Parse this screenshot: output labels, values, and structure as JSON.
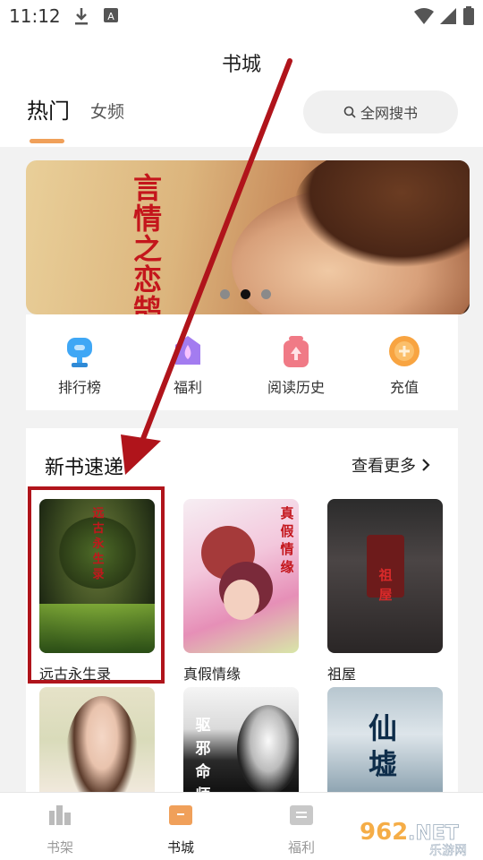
{
  "status_bar": {
    "time": "11:12"
  },
  "page_title": "书城",
  "tabs": [
    {
      "label": "热门",
      "active": true
    },
    {
      "label": "女频",
      "active": false
    }
  ],
  "search": {
    "label": "全网搜书"
  },
  "banner": {
    "title_chars": [
      "言",
      "情",
      "之",
      "恋",
      "鹄"
    ],
    "page_count": 3,
    "active_page": 2
  },
  "quick_actions": [
    {
      "label": "排行榜",
      "icon": "trophy-icon",
      "color": "#3fa7f5"
    },
    {
      "label": "福利",
      "icon": "gift-icon",
      "color": "#a37cf0"
    },
    {
      "label": "阅读历史",
      "icon": "history-icon",
      "color": "#f07a86"
    },
    {
      "label": "充值",
      "icon": "coin-icon",
      "color": "#f8a441"
    }
  ],
  "new_books": {
    "title": "新书速递",
    "more_label": "查看更多",
    "books": [
      {
        "name": "远古永生录",
        "cover_text": "远古永生录"
      },
      {
        "name": "真假情缘",
        "cover_text": "真假情缘"
      },
      {
        "name": "祖屋",
        "cover_text": "祖屋"
      },
      {
        "name": "",
        "cover_text": ""
      },
      {
        "name": "",
        "cover_text": "驱邪命师"
      },
      {
        "name": "",
        "cover_text": "仙墟"
      }
    ]
  },
  "bottom_nav": [
    {
      "label": "书架",
      "icon": "bookshelf-icon",
      "active": false
    },
    {
      "label": "书城",
      "icon": "bookstore-icon",
      "active": true
    },
    {
      "label": "福利",
      "icon": "welfare-icon",
      "active": false
    }
  ],
  "watermark": {
    "text": "962.NET",
    "subtext": "乐游网"
  },
  "colors": {
    "accent": "#f0a05a",
    "annotation_red": "#b0141b"
  }
}
